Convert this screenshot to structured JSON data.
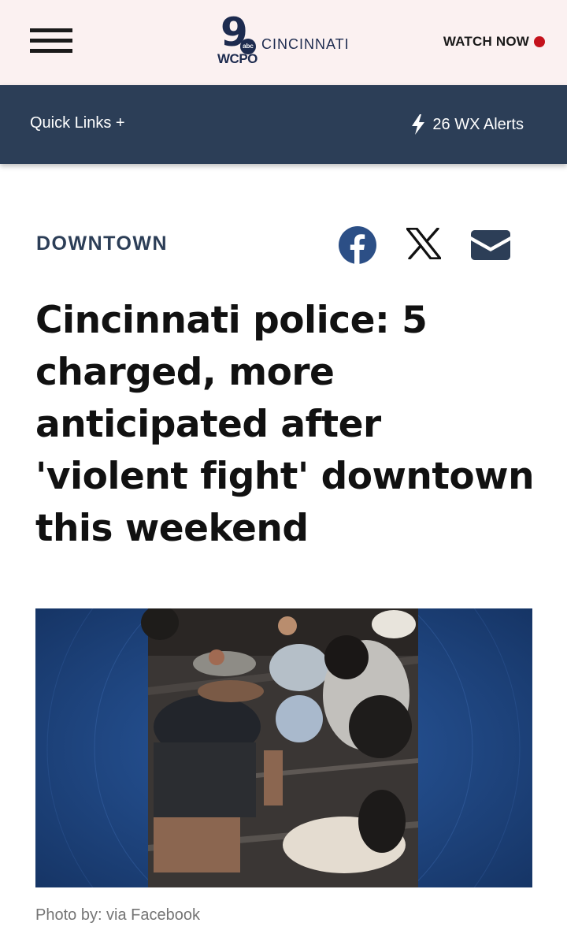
{
  "header": {
    "menu_icon": "hamburger-menu-icon",
    "logo": {
      "number": "9",
      "network": "abc",
      "station": "WCPO",
      "city": "CINCINNATI"
    },
    "watch_now_label": "WATCH NOW",
    "live_dot_color": "#c4121c"
  },
  "subnav": {
    "quick_links_label": "Quick Links +",
    "alerts_icon": "lightning-bolt-icon",
    "alerts_label": "26 WX Alerts"
  },
  "article": {
    "section": "DOWNTOWN",
    "share": [
      {
        "name": "facebook",
        "icon": "facebook-icon"
      },
      {
        "name": "x",
        "icon": "x-icon"
      },
      {
        "name": "email",
        "icon": "envelope-icon"
      }
    ],
    "headline": "Cincinnati police: 5 charged, more anticipated after 'violent fight' downtown this weekend",
    "photo_caption": "Photo by: via Facebook"
  },
  "colors": {
    "top_bar_bg": "#fbf1f1",
    "nav_bar_bg": "#2c3e57",
    "brand_navy": "#1d2b4f",
    "facebook_blue": "#2c4f86",
    "photo_frame_blue": "#1b3e76"
  }
}
